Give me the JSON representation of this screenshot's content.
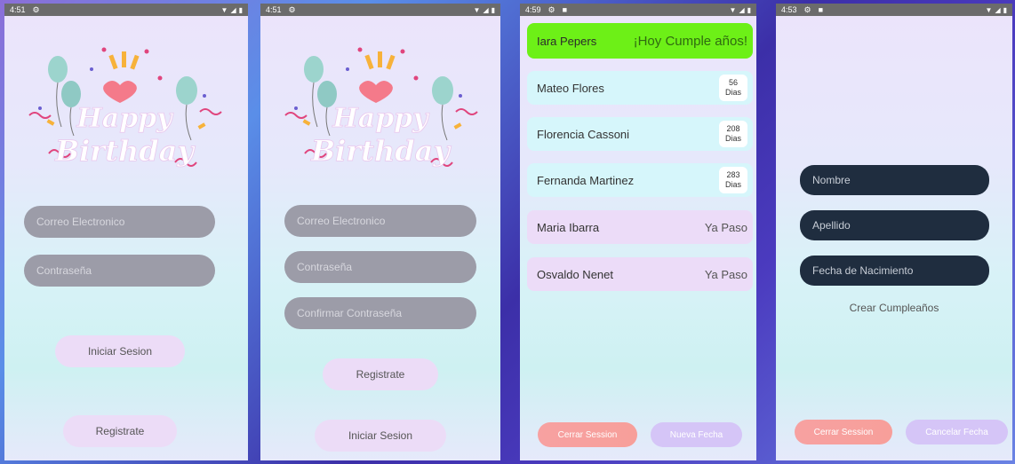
{
  "screens": [
    {
      "status": {
        "time": "4:51"
      },
      "email_placeholder": "Correo Electronico",
      "password_placeholder": "Contraseña",
      "login_label": "Iniciar Sesion",
      "register_label": "Registrate"
    },
    {
      "status": {
        "time": "4:51"
      },
      "email_placeholder": "Correo Electronico",
      "password_placeholder": "Contraseña",
      "confirm_placeholder": "Confirmar Contraseña",
      "register_label": "Registrate",
      "login_label": "Iniciar Sesion"
    },
    {
      "status": {
        "time": "4:59"
      },
      "today": {
        "name": "Iara Pepers",
        "message": "¡Hoy Cumple años!"
      },
      "list": [
        {
          "name": "Mateo Flores",
          "days": "56",
          "unit": "Dias"
        },
        {
          "name": "Florencia  Cassoni",
          "days": "208",
          "unit": "Dias"
        },
        {
          "name": "Fernanda Martinez",
          "days": "283",
          "unit": "Dias"
        },
        {
          "name": "Maria Ibarra",
          "status": "Ya Paso"
        },
        {
          "name": "Osvaldo Nenet",
          "status": "Ya Paso"
        }
      ],
      "logout_label": "Cerrar Session",
      "new_date_label": "Nueva Fecha"
    },
    {
      "status": {
        "time": "4:53"
      },
      "name_placeholder": "Nombre",
      "lastname_placeholder": "Apellido",
      "birthdate_placeholder": "Fecha de Nacimiento",
      "create_label": "Crear Cumpleaños",
      "logout_label": "Cerrar Session",
      "cancel_label": "Cancelar Fecha"
    }
  ],
  "art": {
    "line1": "Happy",
    "line2": "Birthday"
  },
  "colors": {
    "field": "#9c9ca8",
    "dark_field": "#1f2d3f",
    "today_green": "#6df017",
    "row_cyan": "#d6f6fb",
    "row_lavender": "#ecdcf8",
    "button_red": "#f7a1a1",
    "button_violet": "#d5c5f7"
  },
  "icons": [
    "settings-icon",
    "notification-icon",
    "wifi-icon",
    "signal-icon",
    "battery-icon"
  ]
}
